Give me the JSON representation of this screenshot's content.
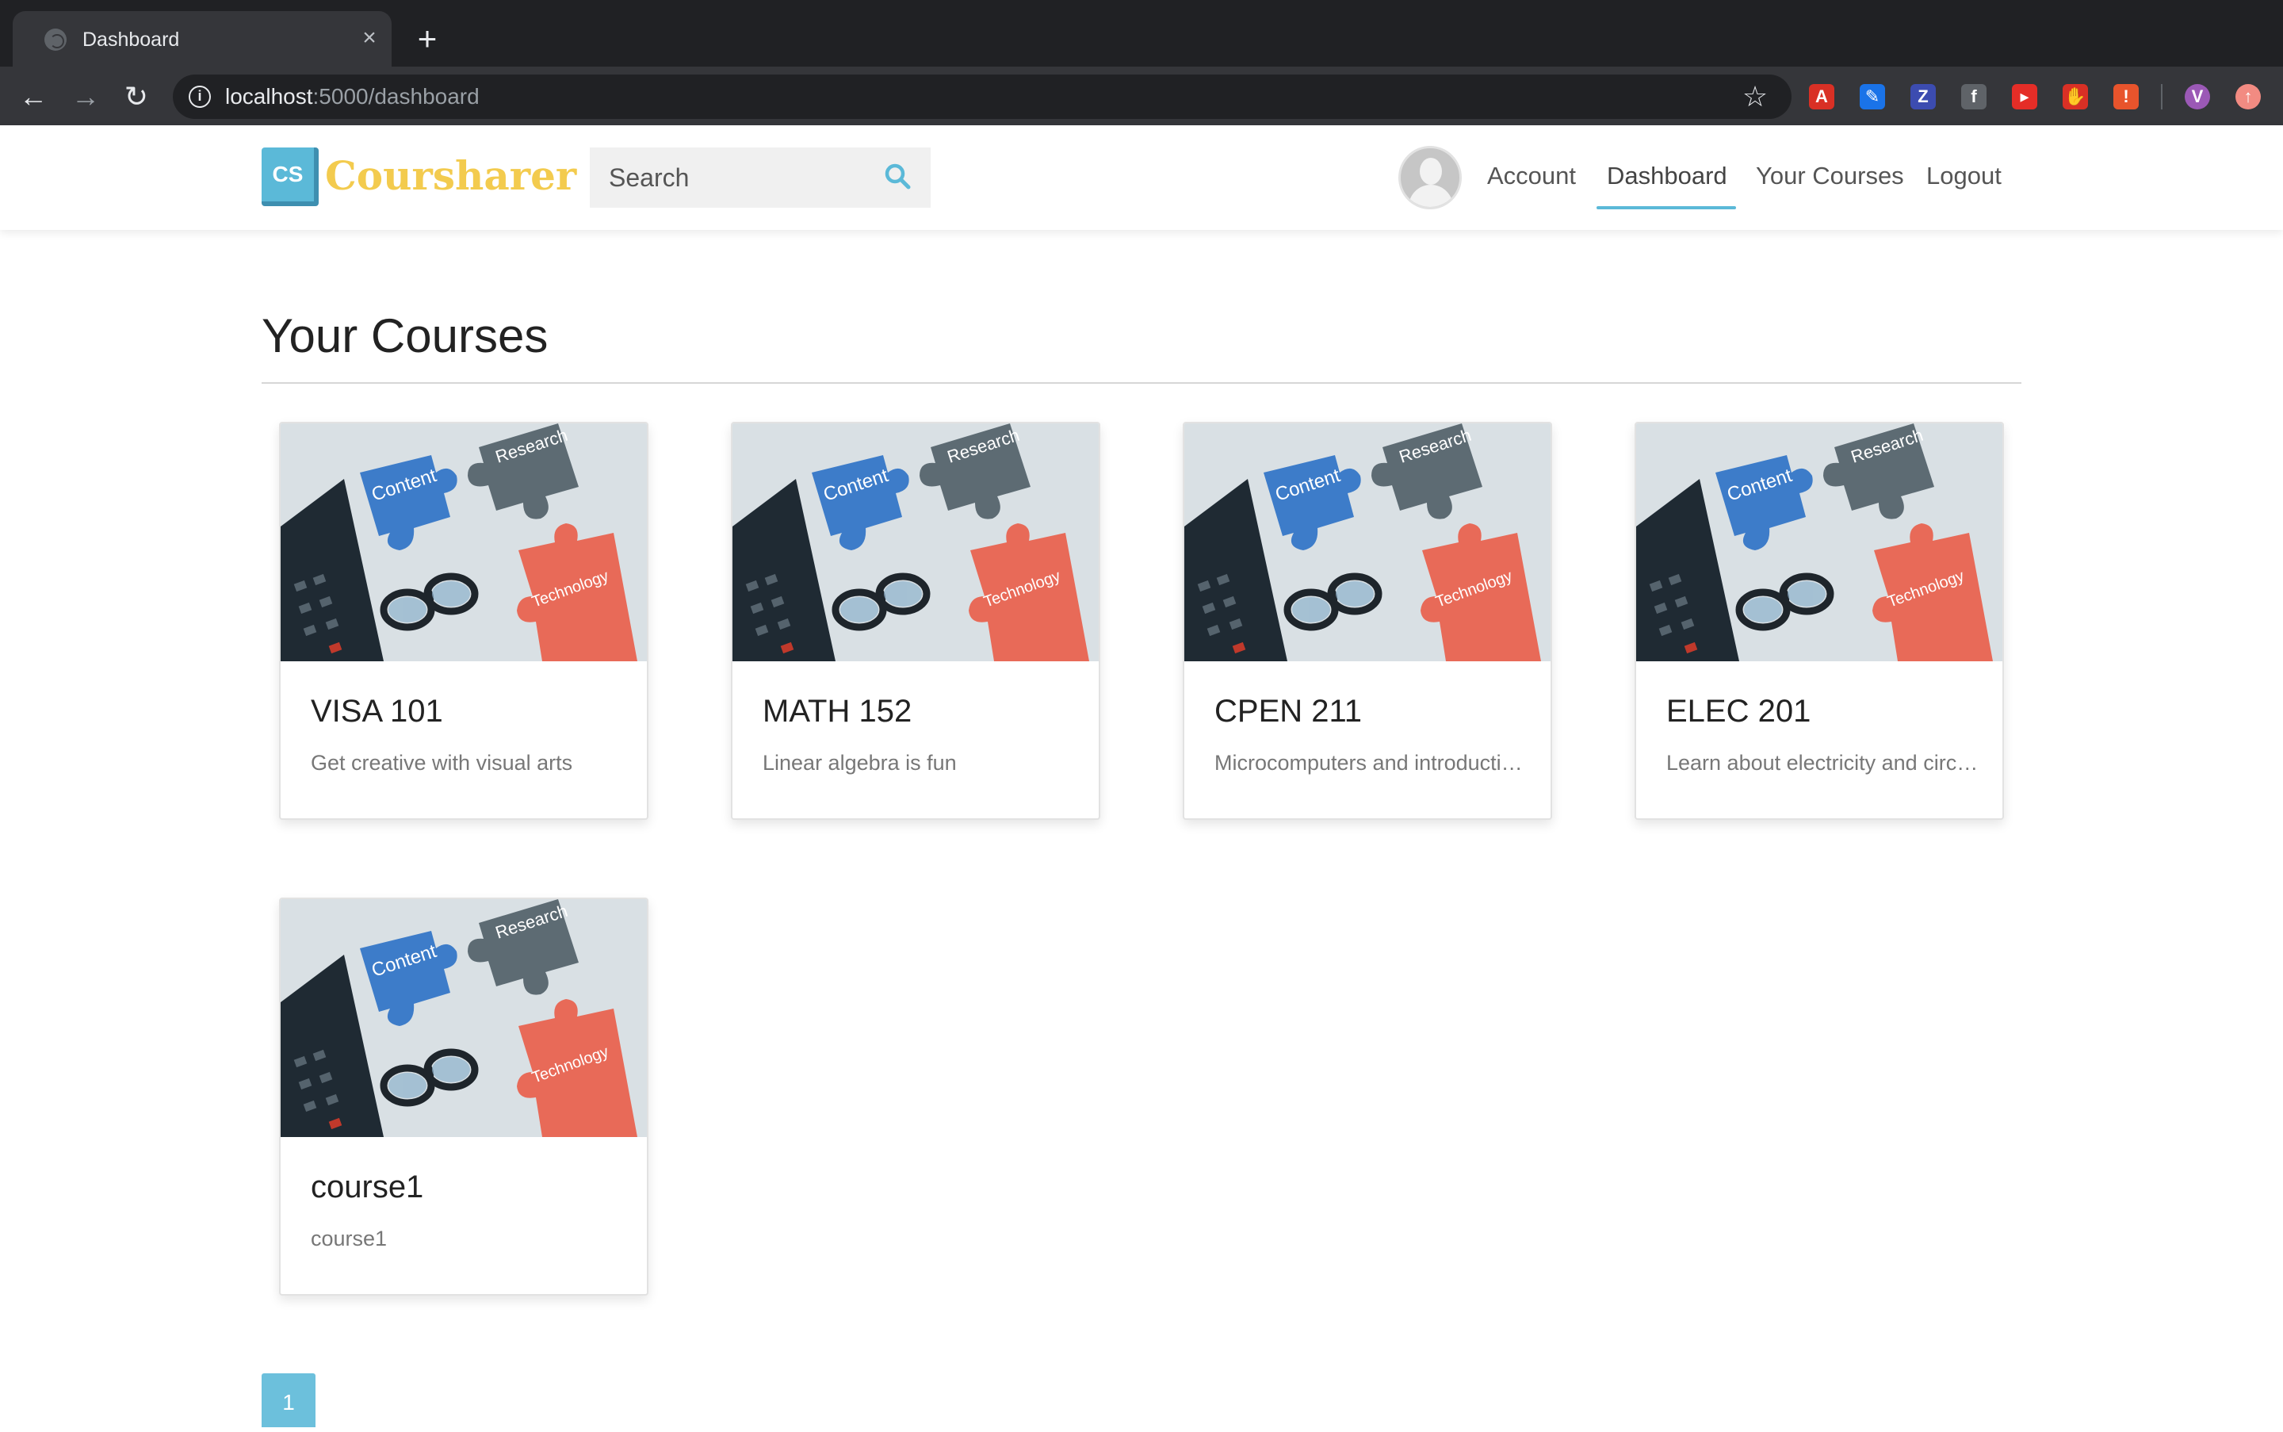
{
  "browser": {
    "tab_title": "Dashboard",
    "url_host": "localhost",
    "url_path": ":5000/dashboard",
    "extensions": [
      {
        "name": "acrobat-extension-icon",
        "glyph": "A",
        "color": "#d93025"
      },
      {
        "name": "highlighter-extension-icon",
        "glyph": "✎",
        "color": "#1a73e8"
      },
      {
        "name": "zotero-extension-icon",
        "glyph": "Z",
        "color": "#3c4cb0"
      },
      {
        "name": "facebook-extension-icon",
        "glyph": "f",
        "color": "#5f6368"
      },
      {
        "name": "youtube-extension-icon",
        "glyph": "▸",
        "color": "#e52d27"
      },
      {
        "name": "adblock-extension-icon",
        "glyph": "✋",
        "color": "#d93025"
      },
      {
        "name": "alert-extension-icon",
        "glyph": "!",
        "color": "#e8542c"
      },
      {
        "name": "profile-avatar-icon",
        "glyph": "V",
        "color": "#9b59b6"
      },
      {
        "name": "update-extension-icon",
        "glyph": "↑",
        "color": "#f28b82"
      }
    ]
  },
  "navbar": {
    "logo_mark": "CS",
    "logo_text": "Coursharer",
    "search_placeholder": "Search",
    "links": {
      "account": "Account",
      "dashboard": "Dashboard",
      "your_courses": "Your Courses",
      "logout": "Logout"
    },
    "active_link": "Dashboard"
  },
  "main": {
    "title": "Your Courses",
    "image_words": {
      "content": "Content",
      "research": "Research",
      "technology": "Technology"
    },
    "courses": [
      {
        "title": "VISA 101",
        "description": "Get creative with visual arts"
      },
      {
        "title": "MATH 152",
        "description": "Linear algebra is fun"
      },
      {
        "title": "CPEN 211",
        "description": "Microcomputers and introduction to computer architecture"
      },
      {
        "title": "ELEC 201",
        "description": "Learn about electricity and circuits"
      },
      {
        "title": "course1",
        "description": "course1"
      }
    ],
    "pagination": {
      "current_page": "1"
    }
  },
  "colors": {
    "accent": "#5bb9d8",
    "logo_yellow": "#f3cb4e",
    "puzzle_blue": "#3d7cc9",
    "puzzle_gray": "#5d6b73",
    "puzzle_red": "#e86a58"
  }
}
